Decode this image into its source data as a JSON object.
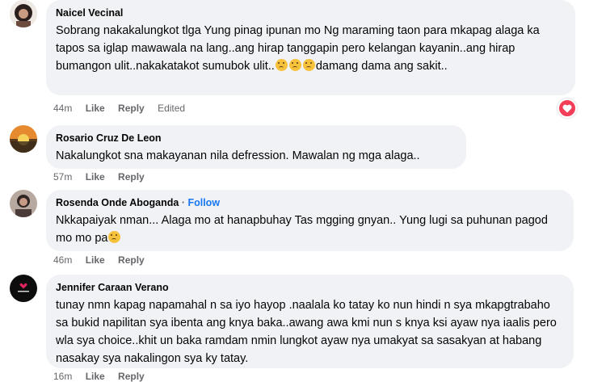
{
  "comments": [
    {
      "author": "Naicel Vecinal",
      "text": "Sobrang nakakalungkot tlga Yung pinag ipunan mo Ng maraming taon para mkapag alaga ka tapos sa iglap mawawala na lang..ang hirap tanggapin pero kelangan kayanin..ang hirap bumangon ulit..nakakatakot sumubok ulit..",
      "text_after": "damang dama ang sakit..",
      "time": "44m",
      "like": "Like",
      "reply": "Reply",
      "edited": "Edited",
      "reaction_icon": "heart-reaction"
    },
    {
      "author": "Rosario Cruz De Leon",
      "text": "Nakalungkot sna makayanan nila defression. Mawalan ng mga alaga..",
      "time": "57m",
      "like": "Like",
      "reply": "Reply"
    },
    {
      "author": "Rosenda Onde Aboganda",
      "separator": "·",
      "follow": "Follow",
      "text": "Nkkapaiyak nman... Alaga mo at hanapbuhay Tas mgging gnyan.. Yung lugi sa puhunan pagod mo mo pa",
      "time": "46m",
      "like": "Like",
      "reply": "Reply"
    },
    {
      "author": "Jennifer Caraan Verano",
      "text": "tunay nmn kapag napamahal n sa iyo hayop .naalala ko tatay ko nun hindi n sya mkapgtrabaho sa bukid napilitan sya ibenta ang knya baka..awang awa kmi nun s knya ksi ayaw nya iaalis pero wla sya choice..khit un baka ramdam nmin lungkot ayaw nya umakyat sa sasakyan at habang nasakay sya nakalingon sya ky tatay.",
      "time": "16m",
      "like": "Like",
      "reply": "Reply"
    }
  ],
  "colors": {
    "bubble": "#f0f2f5",
    "meta": "#65676b",
    "follow": "#1877f2",
    "heart": "#f33e58"
  }
}
